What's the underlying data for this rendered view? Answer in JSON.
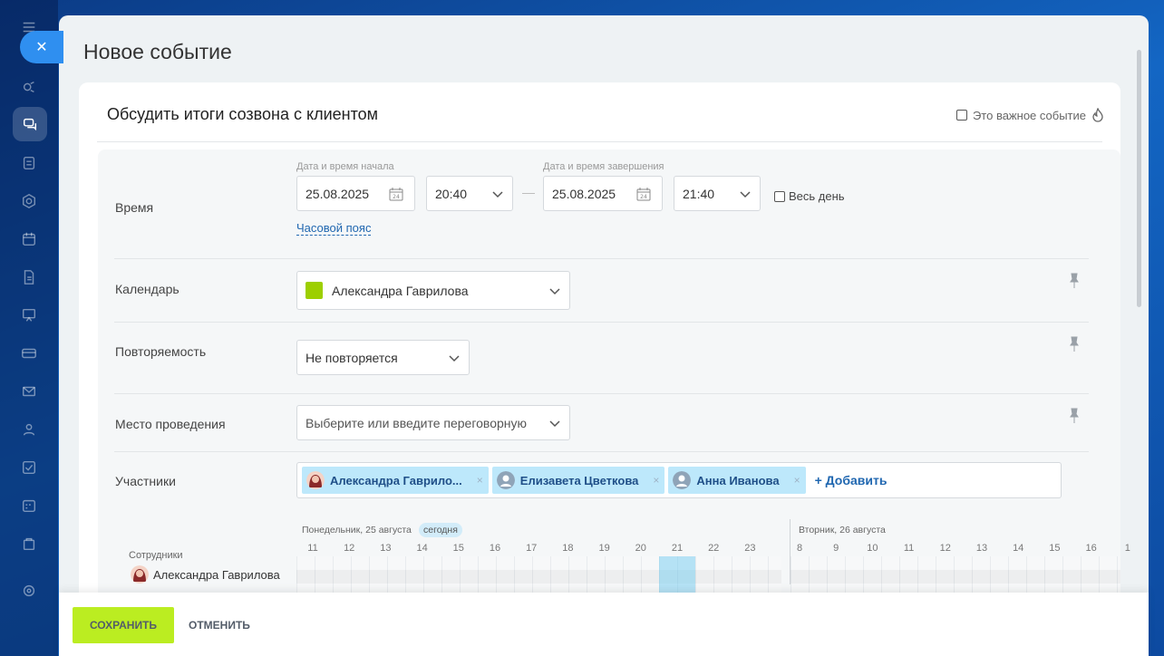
{
  "panel": {
    "title": "Новое событие",
    "close_icon": "✕"
  },
  "event": {
    "name": "Обсудить итоги созвона с клиентом",
    "important_label": "Это важное событие"
  },
  "time": {
    "label": "Время",
    "start_label": "Дата и время начала",
    "end_label": "Дата и время завершения",
    "start_date": "25.08.2025",
    "start_time": "20:40",
    "end_date": "25.08.2025",
    "end_time": "21:40",
    "separator": "—",
    "all_day_label": "Весь день",
    "timezone_link": "Часовой пояс"
  },
  "calendar": {
    "label": "Календарь",
    "value": "Александра Гаврилова",
    "color": "#9dcf00"
  },
  "repeat": {
    "label": "Повторяемость",
    "value": "Не повторяется"
  },
  "location": {
    "label": "Место проведения",
    "placeholder": "Выберите или введите переговорную"
  },
  "attendees": {
    "label": "Участники",
    "items": [
      {
        "name": "Александра Гаврило..."
      },
      {
        "name": "Елизавета Цветкова"
      },
      {
        "name": "Анна Иванова"
      }
    ],
    "remove_icon": "×",
    "add_label": "+ Добавить"
  },
  "planner": {
    "day1_label": "Понедельник, 25 августа",
    "today_label": "сегодня",
    "day2_label": "Вторник, 26 августа",
    "day1_hours": [
      "11",
      "12",
      "13",
      "14",
      "15",
      "16",
      "17",
      "18",
      "19",
      "20",
      "21",
      "22",
      "23"
    ],
    "day2_hours": [
      "8",
      "9",
      "10",
      "11",
      "12",
      "13",
      "14",
      "15",
      "16",
      "1"
    ],
    "employees_label": "Сотрудники",
    "employee_name": "Александра Гаврилова"
  },
  "footer": {
    "save_label": "СОХРАНИТЬ",
    "cancel_label": "ОТМЕНИТЬ"
  },
  "colors": {
    "accent": "#bbed21",
    "link": "#2067b0",
    "chip": "#bde8fb",
    "close": "#2f8ff0"
  }
}
